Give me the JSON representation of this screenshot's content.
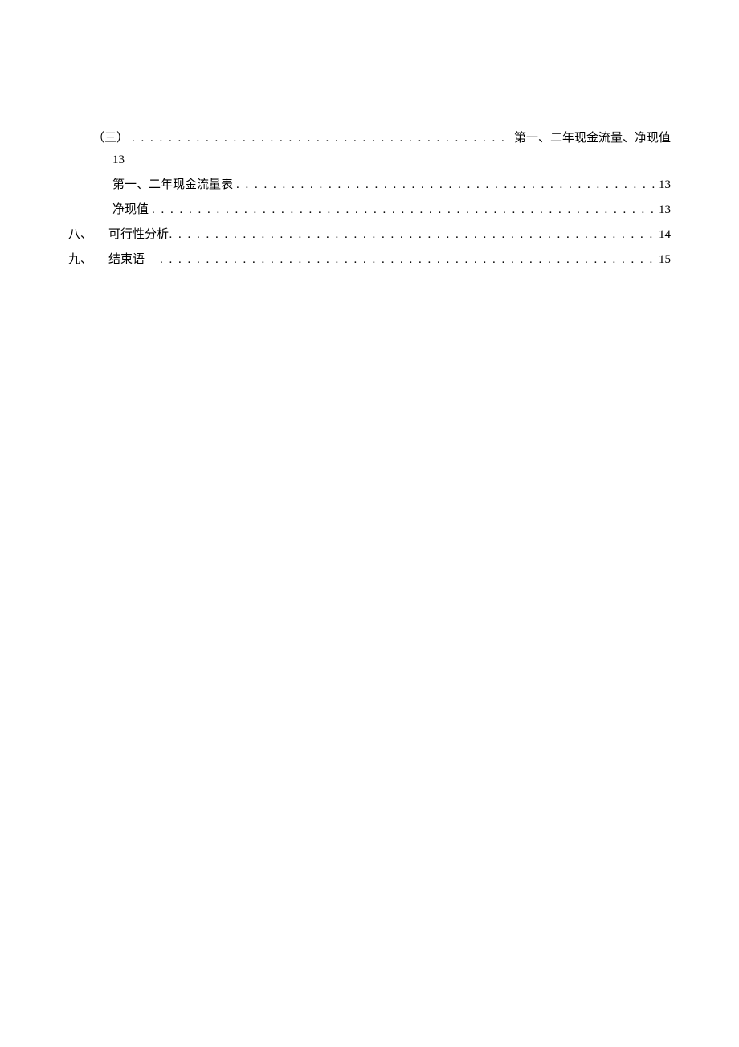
{
  "toc": {
    "entry1": {
      "label": "（三）",
      "right": "第一、二年现金流量、净现值",
      "page": "13"
    },
    "entry2": {
      "label": "第一、二年现金流量表",
      "page": "13"
    },
    "entry3": {
      "label": "净现值",
      "page": "13"
    },
    "entry4": {
      "marker": "八、",
      "label": "可行性分析",
      "page": "14"
    },
    "entry5": {
      "marker": "九、",
      "label": "结束语",
      "page": "15"
    }
  }
}
